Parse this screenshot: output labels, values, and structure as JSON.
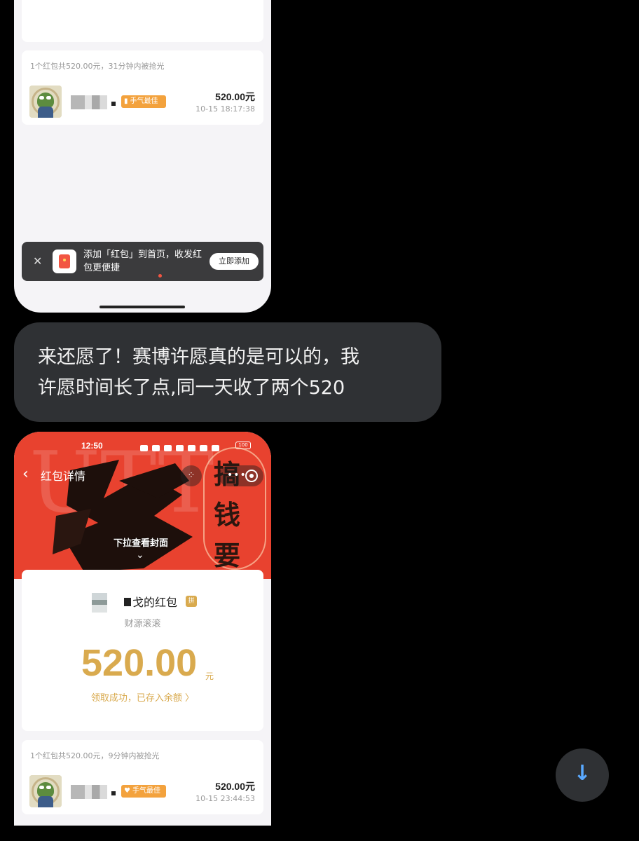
{
  "shot1": {
    "summary": "1个红包共520.00元，31分钟内被抢光",
    "entry": {
      "badge": "手气最佳",
      "amount": "520.00元",
      "time": "10-15 18:17:38"
    },
    "add_bar": {
      "text": "添加「红包」到首页，收发红包更便捷",
      "button": "立即添加"
    }
  },
  "message": {
    "line1": "来还愿了！赛博许愿真的是可以的，我",
    "line2": "许愿时间长了点,同一天收了两个520"
  },
  "shot2": {
    "status_time": "12:50",
    "battery": "100",
    "nav_title": "红包详情",
    "cover_big_text": "UTT",
    "deco_chars": [
      "搞",
      "钱",
      "要"
    ],
    "pull_hint": "下拉查看封面",
    "sender_name": "戈的红包",
    "pin_badge": "拼",
    "blessing": "财源滚滚",
    "amount": "520.00",
    "unit": "元",
    "deposit": "领取成功，已存入余额 〉",
    "summary": "1个红包共520.00元，9分钟内被抢光",
    "entry": {
      "badge": "手气最佳",
      "amount": "520.00元",
      "time": "10-15 23:44:53"
    }
  },
  "colors": {
    "accent_red": "#e8422f",
    "gold": "#d9aa4e",
    "badge_orange": "#f3a23d",
    "bubble": "#2f3134",
    "link_blue": "#5aa9ff"
  },
  "icons": [
    "close-icon",
    "red-packet-icon",
    "back-icon",
    "more-icon",
    "target-icon",
    "chevron-down-icon",
    "arrow-down-icon"
  ]
}
